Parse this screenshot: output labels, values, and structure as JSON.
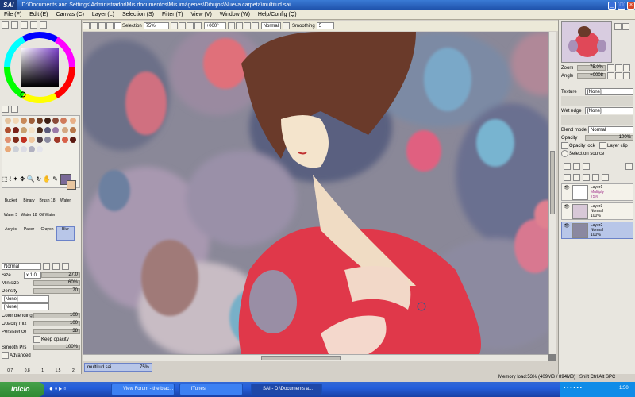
{
  "app": {
    "logo": "SAI",
    "title": "D:\\Documents and Settings\\Administrador\\Mis documentos\\Mis imágenes\\Dibujos\\Nueva carpeta\\multitud.sai"
  },
  "menu": [
    "File (F)",
    "Edit (E)",
    "Canvas (C)",
    "Layer (L)",
    "Selection (S)",
    "Filter (T)",
    "View (V)",
    "Window (W)",
    "Help/Config (Q)"
  ],
  "toolbar": {
    "selection_label": "Selection",
    "zoom": "75%",
    "angle": "+000°",
    "mode": "Normal",
    "smoothing_label": "Smoothing",
    "smoothing_value": "5"
  },
  "tools": {
    "row1": [
      "Bucket",
      "Binary",
      "Brush 18",
      "Water"
    ],
    "row2": [
      "Water 5",
      "Water 18",
      "Oil Water",
      ""
    ],
    "row3": [
      "Acrylic",
      "Paper",
      "Crayon",
      "Blur"
    ]
  },
  "brush": {
    "mode": "Normal",
    "size_mult": "x 1.0",
    "size_value": "27.0",
    "min_size": "60%",
    "density": "70",
    "none1": "[None]",
    "none2": "[None]",
    "color_blending": "100",
    "opacity_mix": "100",
    "persistence": "38",
    "keep_opacity": "Keep opacity",
    "smooth_prs": "100%",
    "advanced": "Advanced",
    "labels": {
      "size": "Size",
      "min_size": "Min size",
      "density": "Density",
      "color_blending": "Color blending",
      "opacity_mix": "Opacity mix",
      "persistence": "Persistence",
      "smooth_prs": "Smooth Prs"
    },
    "presets": [
      "0.7",
      "0.8",
      "1",
      "1.5",
      "2"
    ]
  },
  "navigator": {
    "zoom_label": "Zoom",
    "zoom_value": "75.0%",
    "angle_label": "Angle",
    "angle_value": "+0008"
  },
  "layer_props": {
    "texture_label": "Texture",
    "texture_value": "[None]",
    "wet_edge_label": "Wet edge",
    "wet_edge_value": "[None]",
    "blend_mode_label": "Blend mode",
    "blend_mode_value": "Normal",
    "opacity_label": "Opacity",
    "opacity_value": "100%",
    "opacity_lock": "Opacity lock",
    "layer_clip": "Layer clip",
    "selection_source": "Selection source"
  },
  "layers": [
    {
      "name": "Layer1",
      "mode": "Multiply",
      "opacity": "75%",
      "selected": false
    },
    {
      "name": "Layer3",
      "mode": "Normal",
      "opacity": "100%",
      "selected": false
    },
    {
      "name": "Layer2",
      "mode": "Normal",
      "opacity": "100%",
      "selected": true
    }
  ],
  "document_tab": {
    "name": "multitud.sai",
    "zoom": "75%"
  },
  "status": {
    "memory": "Memory load:53% (409MB / 894MB)",
    "keys": "Shift Ctrl Alt SPC"
  },
  "taskbar": {
    "start": "Inicio",
    "items": [
      {
        "label": "View Forum - the blac...",
        "active": false
      },
      {
        "label": "iTunes",
        "active": false
      },
      {
        "label": "SAI - D:\\Documents a...",
        "active": true
      }
    ],
    "clock": "1:50"
  },
  "colors": {
    "accent": "#316ac5",
    "taskbar": "#245edb",
    "start": "#3c9a3f",
    "selection": "#b8c6e8"
  }
}
